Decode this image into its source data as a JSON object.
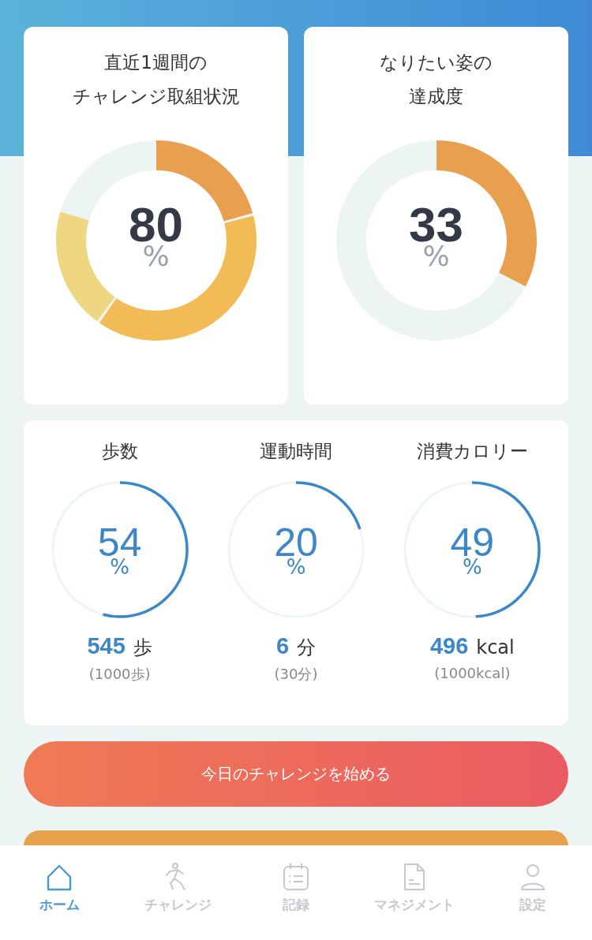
{
  "cards": [
    {
      "title_lines": [
        "直近1週間の",
        "チャレンジ取組状況"
      ],
      "value": "80",
      "unit": "%",
      "segments": [
        {
          "color": "#e8a04e"
        },
        {
          "color": "#f2bb55"
        },
        {
          "color": "#efd781"
        }
      ]
    },
    {
      "title_lines": [
        "なりたい姿の",
        "達成度"
      ],
      "value": "33",
      "unit": "%",
      "segments": [
        {
          "color": "#e8a04e"
        }
      ]
    }
  ],
  "stats": [
    {
      "label": "歩数",
      "value": "54",
      "unit": "%",
      "amount": "545",
      "amount_unit": "歩",
      "goal": "(1000歩)"
    },
    {
      "label": "運動時間",
      "value": "20",
      "unit": "%",
      "amount": "6",
      "amount_unit": "分",
      "goal": "(30分)"
    },
    {
      "label": "消費カロリー",
      "value": "49",
      "unit": "%",
      "amount": "496",
      "amount_unit": "kcal",
      "goal": "(1000kcal)"
    }
  ],
  "start_button": "今日のチャレンジを始める",
  "nav": [
    {
      "kind": "home",
      "label": "ホーム",
      "selected": true
    },
    {
      "kind": "runner",
      "label": "チャレンジ",
      "selected": false
    },
    {
      "kind": "calendar",
      "label": "記録",
      "selected": false
    },
    {
      "kind": "document",
      "label": "マネジメント",
      "selected": false
    },
    {
      "kind": "person",
      "label": "設定",
      "selected": false
    }
  ]
}
